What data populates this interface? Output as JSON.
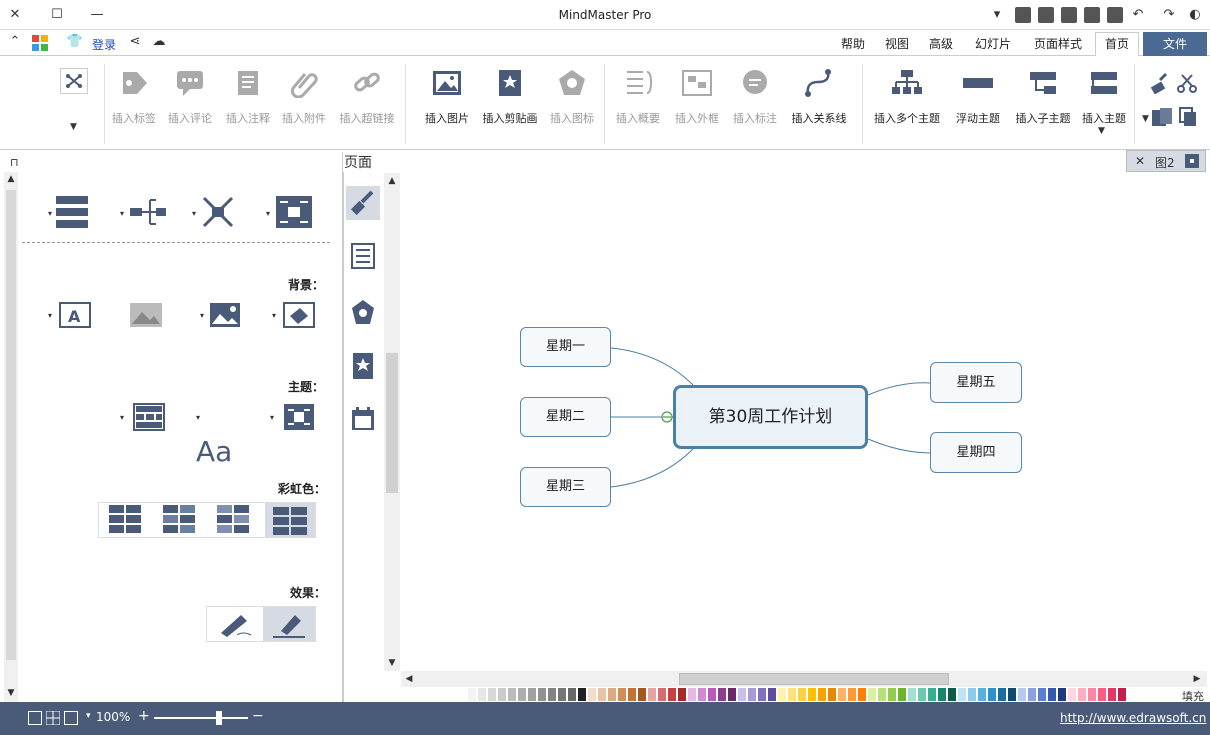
{
  "window": {
    "title": "MindMaster Pro"
  },
  "quick_access": {
    "login_label": "登录"
  },
  "tabs": [
    {
      "label": "文件"
    },
    {
      "label": "首页"
    },
    {
      "label": "页面样式"
    },
    {
      "label": "幻灯片"
    },
    {
      "label": "高级"
    },
    {
      "label": "视图"
    },
    {
      "label": "帮助"
    }
  ],
  "ribbon": {
    "insert_topic": "插入主题",
    "insert_subtopic": "插入子主题",
    "floating_topic": "浮动主题",
    "insert_multiple": "插入多个主题",
    "insert_relation": "插入关系线",
    "insert_callout": "插入标注",
    "insert_boundary": "插入外框",
    "insert_summary": "插入概要",
    "insert_icon": "插入图标",
    "insert_clipart": "插入剪贴画",
    "insert_image": "插入图片",
    "insert_hyperlink": "插入超链接",
    "insert_attachment": "插入附件",
    "insert_note": "插入注释",
    "insert_comment": "插入评论",
    "insert_tag": "插入标签"
  },
  "doc_tab": {
    "label": "图2"
  },
  "panel": {
    "title": "页面",
    "background_label": "背景：",
    "theme_label": "主题：",
    "rainbow_label": "彩虹色：",
    "effect_label": "效果："
  },
  "mindmap": {
    "center": "第30周工作计划",
    "left": [
      "星期五",
      "星期四"
    ],
    "right": [
      "星期一",
      "星期二",
      "星期三"
    ]
  },
  "color_strip": {
    "label": "填充"
  },
  "status": {
    "zoom": "100%",
    "url": "http://www.edrawsoft.cn"
  },
  "colors": {
    "accent": "#4a6a94",
    "statusbar": "#4a5b7a",
    "node_border": "#5a86aa",
    "center_border": "#4a7fa6"
  }
}
